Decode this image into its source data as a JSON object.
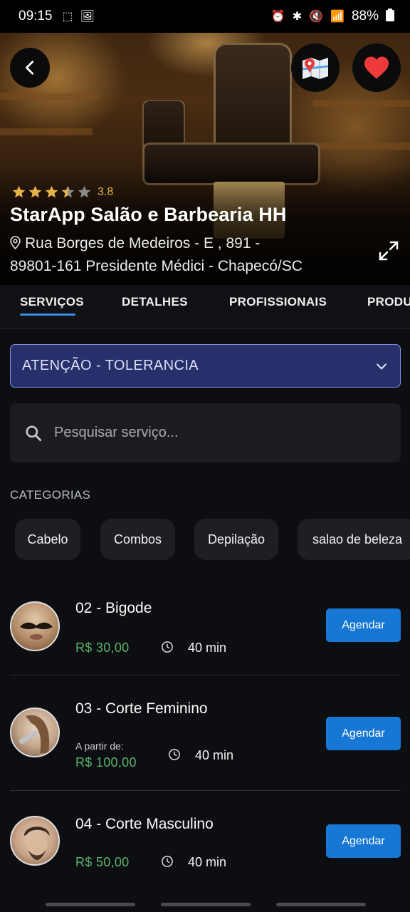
{
  "status_bar": {
    "time": "09:15",
    "battery": "88%",
    "network": "Vo) LTE1"
  },
  "hero": {
    "rating": {
      "value": "3.8",
      "stars": 3.5
    },
    "shop_name": "StarApp Salão e Barbearia HH",
    "address_line1": "Rua Borges de Medeiros - E , 891 -",
    "address_line2": "89801-161 Presidente Médici - Chapecó/SC"
  },
  "tabs": [
    {
      "label": "SERVIÇOS",
      "active": true
    },
    {
      "label": "DETALHES",
      "active": false
    },
    {
      "label": "PROFISSIONAIS",
      "active": false
    },
    {
      "label": "PRODU",
      "active": false
    }
  ],
  "select": {
    "value": "ATENÇÃO - TOLERANCIA"
  },
  "search": {
    "placeholder": "Pesquisar serviço..."
  },
  "categories": {
    "title": "CATEGORIAS",
    "items": [
      "Cabelo",
      "Combos",
      "Depilação",
      "salao de beleza"
    ]
  },
  "services": [
    {
      "name": "02 - Bigode",
      "from_label": "",
      "price": "R$  30,00",
      "duration": "40 min",
      "button": "Agendar"
    },
    {
      "name": "03 - Corte Feminino",
      "from_label": "A partir de:",
      "price": "R$  100,00",
      "duration": "40 min",
      "button": "Agendar"
    },
    {
      "name": "04 - Corte Masculino",
      "from_label": "",
      "price": "R$  50,00",
      "duration": "40 min",
      "button": "Agendar"
    }
  ],
  "colors": {
    "accent": "#1677d4",
    "tab_underline": "#3a8ee6",
    "price": "#58b26a",
    "star": "#e6b34a",
    "select_bg": "#27306a"
  }
}
